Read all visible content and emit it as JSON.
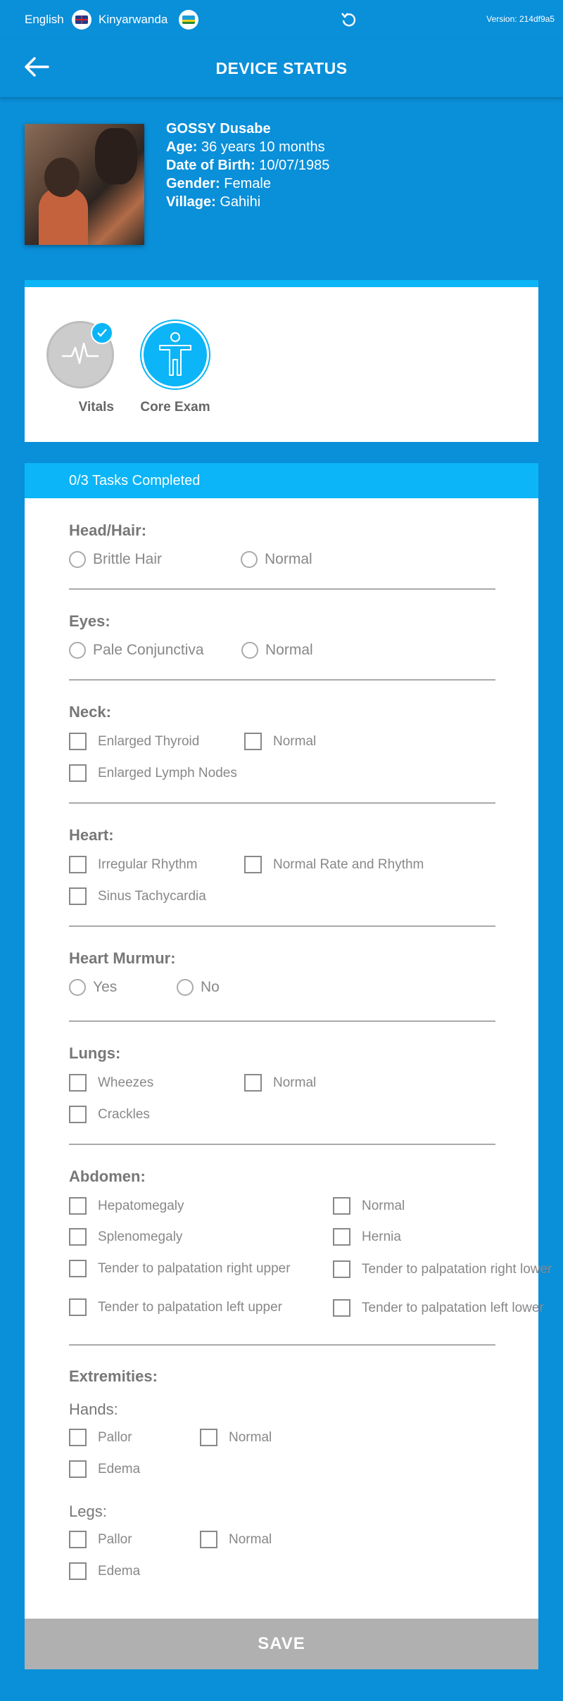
{
  "topbar": {
    "lang_en": "English",
    "lang_rw": "Kinyarwanda",
    "version": "Version: 214df9a5"
  },
  "header": {
    "title": "DEVICE STATUS"
  },
  "patient": {
    "name": "GOSSY Dusabe",
    "age_label": "Age:",
    "age": "36 years 10 months",
    "dob_label": "Date of Birth:",
    "dob": "10/07/1985",
    "gender_label": "Gender:",
    "gender": "Female",
    "village_label": "Village:",
    "village": "Gahihi"
  },
  "tabs": [
    {
      "label": "Vitals",
      "completed": true
    },
    {
      "label": "Core Exam",
      "active": true
    }
  ],
  "progress": "0/3 Tasks Completed",
  "sections": {
    "head": {
      "title": "Head/Hair:",
      "options": [
        "Brittle Hair",
        "Normal"
      ]
    },
    "eyes": {
      "title": "Eyes:",
      "options": [
        "Pale Conjunctiva",
        "Normal"
      ]
    },
    "neck": {
      "title": "Neck:",
      "options": [
        "Enlarged Thyroid",
        "Normal",
        "Enlarged Lymph Nodes"
      ]
    },
    "heart": {
      "title": "Heart:",
      "options": [
        "Irregular Rhythm",
        "Normal Rate and Rhythm",
        "Sinus Tachycardia"
      ]
    },
    "murmur": {
      "title": "Heart Murmur:",
      "options": [
        "Yes",
        "No"
      ]
    },
    "lungs": {
      "title": "Lungs:",
      "options": [
        "Wheezes",
        "Normal",
        "Crackles"
      ]
    },
    "abdomen": {
      "title": "Abdomen:",
      "options": [
        "Hepatomegaly",
        "Normal",
        "Splenomegaly",
        "Hernia",
        "Tender to palpatation right upper",
        "Tender to palpatation right lower",
        "Tender to palpatation left upper",
        "Tender to palpatation left lower"
      ]
    },
    "extremities": {
      "title": "Extremities:",
      "hands": {
        "title": "Hands:",
        "options": [
          "Pallor",
          "Normal",
          "Edema"
        ]
      },
      "legs": {
        "title": "Legs:",
        "options": [
          "Pallor",
          "Normal",
          "Edema"
        ]
      }
    }
  },
  "save_label": "SAVE",
  "colors": {
    "primary": "#0a8fd9",
    "accent": "#0bb5f7",
    "save_disabled": "#b0b0b0"
  }
}
